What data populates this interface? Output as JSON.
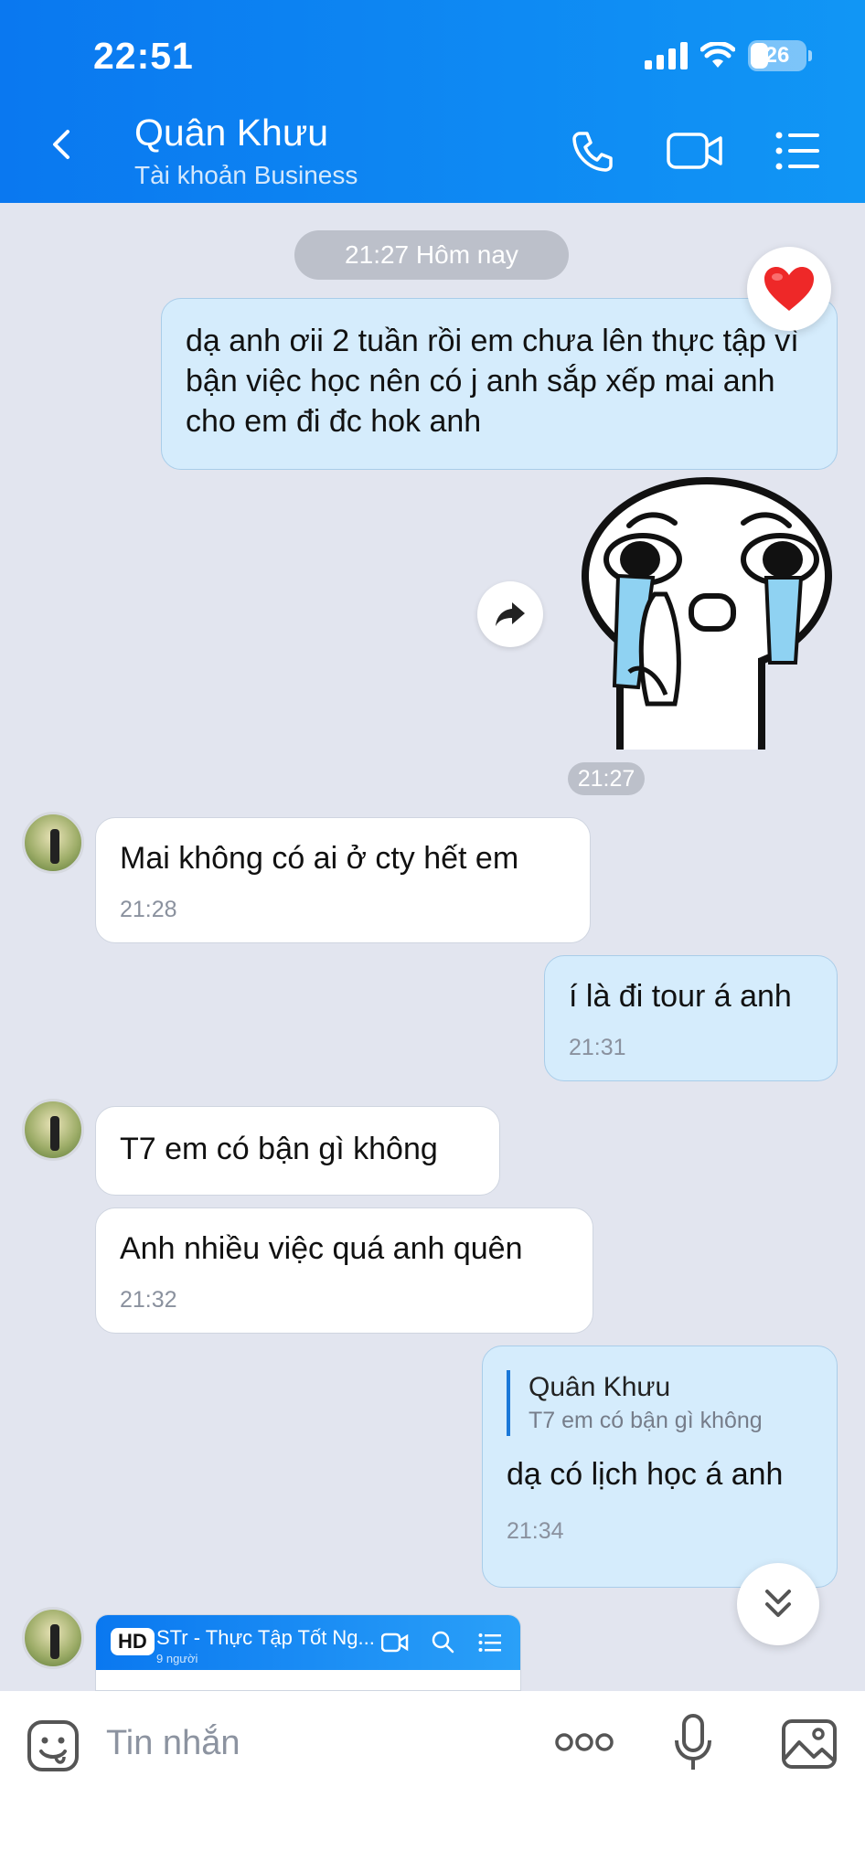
{
  "status": {
    "time": "22:51",
    "battery": "26"
  },
  "header": {
    "title": "Quân Khưu",
    "subtitle": "Tài khoản Business"
  },
  "chat": {
    "date_pill": "21:27 Hôm nay",
    "messages": [
      {
        "text": "dạ anh ơii 2 tuần rồi em chưa lên thực tập vì bận việc học nên có j anh sắp xếp mai anh cho em đi đc hok anh"
      },
      {
        "sticker_time": "21:27"
      },
      {
        "text": "Mai không có ai ở cty hết em",
        "time": "21:28"
      },
      {
        "text": "í là đi tour á anh",
        "time": "21:31"
      },
      {
        "text": "T7 em có bận gì không"
      },
      {
        "text": "Anh nhiều việc quá anh quên",
        "time": "21:32"
      },
      {
        "quote_name": "Quân Khưu",
        "quote_text": "T7 em có bận gì không",
        "text": "dạ có lịch học á anh",
        "time": "21:34"
      }
    ],
    "preview": {
      "badge": "HD",
      "title": "STr - Thực Tập Tốt Ng...",
      "count": "9 người"
    }
  },
  "input": {
    "placeholder": "Tin nhắn"
  }
}
